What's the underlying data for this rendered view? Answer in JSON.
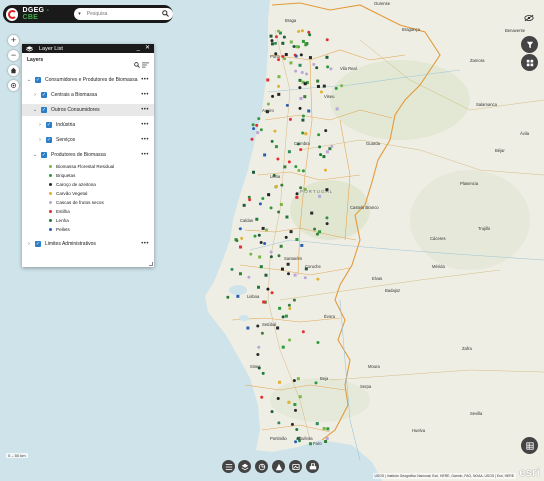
{
  "header": {
    "app_title_main": "DGEG",
    "app_title_sub": " - CBE",
    "search_placeholder": "Pesquisa"
  },
  "layer_list": {
    "title": "Layer List",
    "tools_label": "Layers",
    "layers": [
      {
        "label": "Consumidores e Produtores de Biomassa"
      },
      {
        "label": "Centrais a Biomassa"
      },
      {
        "label": "Outros Consumidores"
      },
      {
        "label": "Indústria"
      },
      {
        "label": "Serviços"
      },
      {
        "label": "Produtores de Biomassa"
      },
      {
        "label": "Limites Administrativos"
      }
    ],
    "legend": [
      {
        "label": "Biomassa Florestal Residual",
        "color": "#7ab648"
      },
      {
        "label": "Briquetas",
        "color": "#2e9a3a"
      },
      {
        "label": "Caroço de azeitona",
        "color": "#2b2b2b"
      },
      {
        "label": "Carvão Vegetal",
        "color": "#e0b030"
      },
      {
        "label": "Cascas de frutos secos",
        "color": "#b9a7d8"
      },
      {
        "label": "Estilha",
        "color": "#e03030"
      },
      {
        "label": "Lenha",
        "color": "#1f7a3a"
      },
      {
        "label": "Pellets",
        "color": "#2a5fb0"
      }
    ]
  },
  "map": {
    "places": [
      "Braga",
      "Porto",
      "Bragança",
      "Zamora",
      "Salamanca",
      "Aveiro",
      "Guarda",
      "Coimbra",
      "Castelo Branco",
      "PORTUGAL",
      "Leiria",
      "Santarém",
      "Lisboa",
      "Setúbal",
      "Évora",
      "Badajoz",
      "Beja",
      "Faro",
      "Huelva",
      "Sevilla",
      "Cáceres",
      "Mérida",
      "Ávila",
      "Plasencia",
      "Trujillo",
      "Zafra",
      "Albufeira",
      "Portimão",
      "Caldas",
      "Coruche",
      "Ourense",
      "Viseu",
      "Vila Real",
      "Béjar",
      "Benavente",
      "Sines",
      "Serpa",
      "Moura",
      "Elvas"
    ],
    "scale_label": "0 ‒ 50 km",
    "attribution": "USGS | Instituto Geográfico Nacional, Esri, HERE, Garmin, FAO, NOAA, USGS | Esri, HERE",
    "esri_logo": "esri"
  },
  "colors": {
    "water": "#cfe3ea",
    "land": "#efeee4",
    "district_border": "#e29a3b",
    "accent": "#2a7dc6"
  }
}
